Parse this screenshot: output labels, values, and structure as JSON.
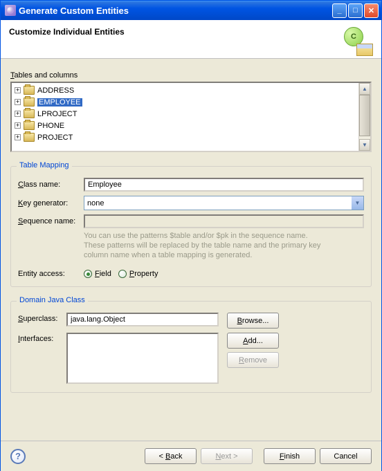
{
  "window": {
    "title": "Generate Custom Entities"
  },
  "header": {
    "title": "Customize Individual Entities"
  },
  "tables_section": {
    "label": "Tables and columns",
    "items": [
      "ADDRESS",
      "EMPLOYEE",
      "LPROJECT",
      "PHONE",
      "PROJECT"
    ],
    "selected_index": 1
  },
  "table_mapping": {
    "legend": "Table Mapping",
    "class_name_label": "Class name:",
    "class_name_value": "Employee",
    "key_generator_label": "Key generator:",
    "key_generator_value": "none",
    "sequence_name_label": "Sequence name:",
    "sequence_name_value": "",
    "hint": "You can use the patterns $table and/or $pk in the sequence name.\nThese patterns will be replaced by the table name and the primary key\ncolumn name when a table mapping is generated.",
    "entity_access_label": "Entity access:",
    "radio_field": "Field",
    "radio_property": "Property",
    "radio_selected": "field"
  },
  "domain_java_class": {
    "legend": "Domain Java Class",
    "superclass_label": "Superclass:",
    "superclass_value": "java.lang.Object",
    "interfaces_label": "Interfaces:",
    "browse_btn": "Browse...",
    "add_btn": "Add...",
    "remove_btn": "Remove"
  },
  "footer": {
    "back": "< Back",
    "next": "Next >",
    "finish": "Finish",
    "cancel": "Cancel"
  }
}
